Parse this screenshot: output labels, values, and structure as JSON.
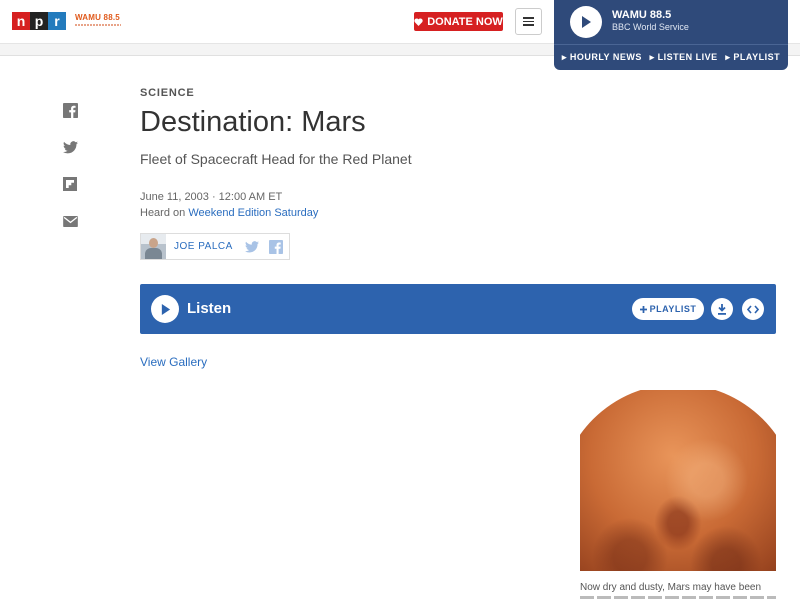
{
  "header": {
    "logo_letters": [
      "n",
      "p",
      "r"
    ],
    "station_logo_text": "WAMU 88.5",
    "donate_label": "DONATE NOW",
    "menu_icon": "hamburger-icon"
  },
  "player": {
    "station": "WAMU 88.5",
    "program": "BBC World Service",
    "links": [
      "HOURLY NEWS",
      "LISTEN LIVE",
      "PLAYLIST"
    ]
  },
  "social": {
    "icons": [
      "facebook-icon",
      "twitter-icon",
      "flipboard-icon",
      "email-icon"
    ]
  },
  "article": {
    "kicker": "SCIENCE",
    "title": "Destination: Mars",
    "subtitle": "Fleet of Spacecraft Head for the Red Planet",
    "dateline": "June 11, 2003 · 12:00 AM ET",
    "heard_on_prefix": "Heard on ",
    "heard_on_program": "Weekend Edition Saturday",
    "byline": {
      "name": "JOE PALCA"
    }
  },
  "listen": {
    "label": "Listen",
    "playlist_label": "PLAYLIST"
  },
  "gallery_link": "View Gallery",
  "photo": {
    "caption": "Now dry and dusty, Mars may have been"
  },
  "colors": {
    "npr_red": "#d62021",
    "npr_blue": "#237bbd",
    "player_bg": "#2f4a7a",
    "listen_bg": "#2d63ae",
    "link": "#2a6dbf"
  }
}
